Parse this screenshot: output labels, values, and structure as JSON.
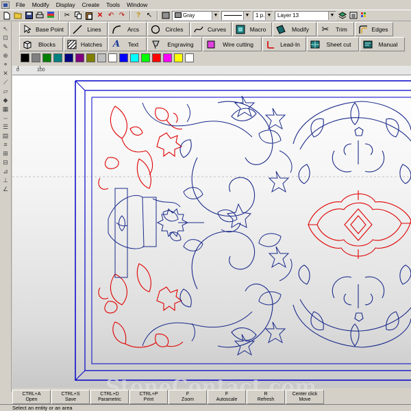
{
  "menu": [
    "File",
    "Modify",
    "Display",
    "Create",
    "Tools",
    "Window"
  ],
  "toolbar": {
    "color_combo": "Gray",
    "lineweight_combo": "1 p.",
    "layer_combo": "Layer 13"
  },
  "tools_row1": [
    {
      "label": "Base Point",
      "icon": "pointer-icon"
    },
    {
      "label": "Lines",
      "icon": "line-icon"
    },
    {
      "label": "Arcs",
      "icon": "arc-icon"
    },
    {
      "label": "Circles",
      "icon": "circle-icon"
    },
    {
      "label": "Curves",
      "icon": "curve-icon"
    },
    {
      "label": "Macro",
      "icon": "macro-icon"
    },
    {
      "label": "Modify",
      "icon": "modify-icon"
    },
    {
      "label": "Trim",
      "icon": "scissors-icon"
    },
    {
      "label": "Edges",
      "icon": "edges-icon"
    }
  ],
  "tools_row2": [
    {
      "label": "Blocks",
      "icon": "block-icon"
    },
    {
      "label": "Hatches",
      "icon": "hatch-icon"
    },
    {
      "label": "Text",
      "icon": "text-icon"
    },
    {
      "label": "Engraving",
      "icon": "engraving-icon"
    },
    {
      "label": "Wire cutting",
      "icon": "wire-icon"
    },
    {
      "label": "Lead-In",
      "icon": "leadin-icon"
    },
    {
      "label": "Sheet cut",
      "icon": "sheet-icon"
    },
    {
      "label": "Manual",
      "icon": "manual-icon"
    }
  ],
  "palette": [
    "#000000",
    "#808080",
    "#008000",
    "#008080",
    "#000080",
    "#800080",
    "#808000",
    "#c0c0c0",
    "#ffffff",
    "#0000ff",
    "#00ffff",
    "#00ff00",
    "#ff0000",
    "#ff00ff",
    "#ffff00",
    "#ffffff"
  ],
  "colors": {
    "accent_blue": "#1a2a8a",
    "accent_red": "#e00000",
    "frame_blue": "#0000c8"
  },
  "ruler": {
    "labels": [
      "0",
      "100"
    ]
  },
  "function_keys": [
    {
      "key": "CTRL+A",
      "action": "Open"
    },
    {
      "key": "CTRL+S",
      "action": "Save"
    },
    {
      "key": "CTRL+D",
      "action": "Parametric"
    },
    {
      "key": "CTRL+P",
      "action": "Print"
    },
    {
      "key": "F",
      "action": "Zoom"
    },
    {
      "key": "F",
      "action": "Autoscale"
    },
    {
      "key": "R",
      "action": "Refresh"
    },
    {
      "key": "Center click",
      "action": "Move"
    }
  ],
  "status": "Select an entity or an area",
  "watermark": "StoneContact.com"
}
